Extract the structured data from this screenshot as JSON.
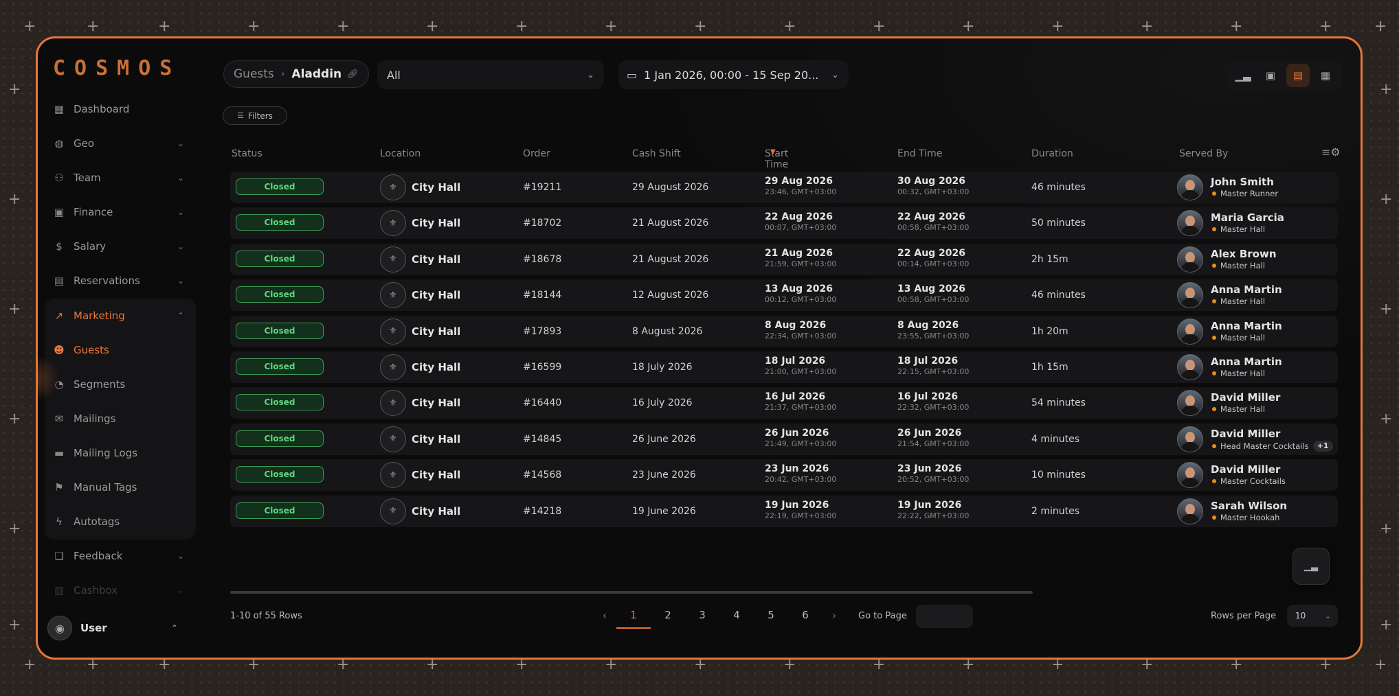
{
  "app": {
    "logo": "COSMOS"
  },
  "sidebar": {
    "items": [
      {
        "label": "Dashboard",
        "icon": "dashboard-icon"
      },
      {
        "label": "Geo",
        "icon": "globe-icon"
      },
      {
        "label": "Team",
        "icon": "team-icon"
      },
      {
        "label": "Finance",
        "icon": "finance-icon"
      },
      {
        "label": "Salary",
        "icon": "salary-icon"
      },
      {
        "label": "Reservations",
        "icon": "reservations-icon"
      },
      {
        "label": "Marketing",
        "icon": "marketing-icon"
      },
      {
        "label": "Guests",
        "icon": "guests-icon"
      },
      {
        "label": "Segments",
        "icon": "segments-icon"
      },
      {
        "label": "Mailings",
        "icon": "mail-icon"
      },
      {
        "label": "Mailing Logs",
        "icon": "chat-icon"
      },
      {
        "label": "Manual Tags",
        "icon": "tag-icon"
      },
      {
        "label": "Autotags",
        "icon": "bolt-icon"
      },
      {
        "label": "Feedback",
        "icon": "feedback-icon"
      },
      {
        "label": "Cashbox",
        "icon": "cashbox-icon"
      }
    ],
    "user": {
      "name": "User"
    }
  },
  "topbar": {
    "breadcrumb": {
      "parent": "Guests",
      "current": "Aladdin"
    },
    "location_select": "All",
    "date_range": "1 Jan 2026, 00:00 - 15 Sep 20...",
    "filters_label": "Filters"
  },
  "table": {
    "headers": {
      "status": "Status",
      "location": "Location",
      "order": "Order",
      "cash_shift": "Cash Shift",
      "start_time": "Start Time",
      "end_time": "End Time",
      "duration": "Duration",
      "served_by": "Served By"
    },
    "rows": [
      {
        "status": "Closed",
        "location": "City Hall",
        "order": "#19211",
        "shift": "29 August 2026",
        "start_date": "29 Aug 2026",
        "start_time": "23:46, GMT+03:00",
        "end_date": "30 Aug 2026",
        "end_time": "00:32, GMT+03:00",
        "duration": "46 minutes",
        "name": "John Smith",
        "role": "Master Runner"
      },
      {
        "status": "Closed",
        "location": "City Hall",
        "order": "#18702",
        "shift": "21 August 2026",
        "start_date": "22 Aug 2026",
        "start_time": "00:07, GMT+03:00",
        "end_date": "22 Aug 2026",
        "end_time": "00:58, GMT+03:00",
        "duration": "50 minutes",
        "name": "Maria Garcia",
        "role": "Master Hall"
      },
      {
        "status": "Closed",
        "location": "City Hall",
        "order": "#18678",
        "shift": "21 August 2026",
        "start_date": "21 Aug 2026",
        "start_time": "21:59, GMT+03:00",
        "end_date": "22 Aug 2026",
        "end_time": "00:14, GMT+03:00",
        "duration": "2h 15m",
        "name": "Alex Brown",
        "role": "Master Hall"
      },
      {
        "status": "Closed",
        "location": "City Hall",
        "order": "#18144",
        "shift": "12 August 2026",
        "start_date": "13 Aug 2026",
        "start_time": "00:12, GMT+03:00",
        "end_date": "13 Aug 2026",
        "end_time": "00:58, GMT+03:00",
        "duration": "46 minutes",
        "name": "Anna Martin",
        "role": "Master Hall"
      },
      {
        "status": "Closed",
        "location": "City Hall",
        "order": "#17893",
        "shift": "8 August 2026",
        "start_date": "8 Aug 2026",
        "start_time": "22:34, GMT+03:00",
        "end_date": "8 Aug 2026",
        "end_time": "23:55, GMT+03:00",
        "duration": "1h 20m",
        "name": "Anna Martin",
        "role": "Master Hall"
      },
      {
        "status": "Closed",
        "location": "City Hall",
        "order": "#16599",
        "shift": "18 July 2026",
        "start_date": "18 Jul 2026",
        "start_time": "21:00, GMT+03:00",
        "end_date": "18 Jul 2026",
        "end_time": "22:15, GMT+03:00",
        "duration": "1h 15m",
        "name": "Anna Martin",
        "role": "Master Hall"
      },
      {
        "status": "Closed",
        "location": "City Hall",
        "order": "#16440",
        "shift": "16 July 2026",
        "start_date": "16 Jul 2026",
        "start_time": "21:37, GMT+03:00",
        "end_date": "16 Jul 2026",
        "end_time": "22:32, GMT+03:00",
        "duration": "54 minutes",
        "name": "David Miller",
        "role": "Master Hall"
      },
      {
        "status": "Closed",
        "location": "City Hall",
        "order": "#14845",
        "shift": "26 June 2026",
        "start_date": "26 Jun 2026",
        "start_time": "21:49, GMT+03:00",
        "end_date": "26 Jun 2026",
        "end_time": "21:54, GMT+03:00",
        "duration": "4 minutes",
        "name": "David Miller",
        "role": "Head Master Cocktails",
        "extra": "+1"
      },
      {
        "status": "Closed",
        "location": "City Hall",
        "order": "#14568",
        "shift": "23 June 2026",
        "start_date": "23 Jun 2026",
        "start_time": "20:42, GMT+03:00",
        "end_date": "23 Jun 2026",
        "end_time": "20:52, GMT+03:00",
        "duration": "10 minutes",
        "name": "David Miller",
        "role": "Master Cocktails"
      },
      {
        "status": "Closed",
        "location": "City Hall",
        "order": "#14218",
        "shift": "19 June 2026",
        "start_date": "19 Jun 2026",
        "start_time": "22:19, GMT+03:00",
        "end_date": "19 Jun 2026",
        "end_time": "22:22, GMT+03:00",
        "duration": "2 minutes",
        "name": "Sarah Wilson",
        "role": "Master Hookah"
      }
    ]
  },
  "footer": {
    "rows_info": "1-10 of 55 Rows",
    "pages": [
      "1",
      "2",
      "3",
      "4",
      "5",
      "6"
    ],
    "current_page": "1",
    "goto_label": "Go to Page",
    "goto_value": "",
    "rows_per_page_label": "Rows per Page",
    "rows_per_page": "10"
  },
  "colors": {
    "accent": "#e8763a",
    "status_closed": "#5fd67e",
    "role_dot": "#f08a1c"
  }
}
